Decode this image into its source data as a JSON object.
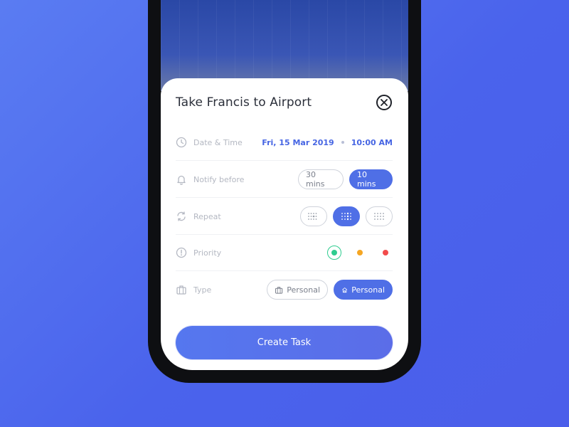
{
  "task": {
    "title": "Take Francis to Airport"
  },
  "rows": {
    "datetime": {
      "label": "Date & Time",
      "date": "Fri, 15 Mar 2019",
      "time": "10:00 AM"
    },
    "notify": {
      "label": "Notify before",
      "options": [
        "30 mins",
        "10 mins"
      ],
      "selected": "10 mins"
    },
    "repeat": {
      "label": "Repeat",
      "options_icons": [
        "repeat-pattern-1-icon",
        "repeat-pattern-2-icon",
        "repeat-pattern-3-icon"
      ],
      "selected_index": 1
    },
    "priority": {
      "label": "Priority",
      "levels": [
        "#2ecc8f",
        "#f5a623",
        "#f24b4b"
      ],
      "selected_index": 0
    },
    "type": {
      "label": "Type",
      "options": [
        "Personal",
        "Personal"
      ],
      "option_icons": [
        "briefcase-icon",
        "home-icon"
      ],
      "selected_index": 1
    }
  },
  "cta": {
    "label": "Create Task"
  },
  "colors": {
    "accent": "#4f6fe6",
    "background": "#4a63ec",
    "text_primary": "#2b2f3a",
    "label": "#b4b8c2"
  }
}
